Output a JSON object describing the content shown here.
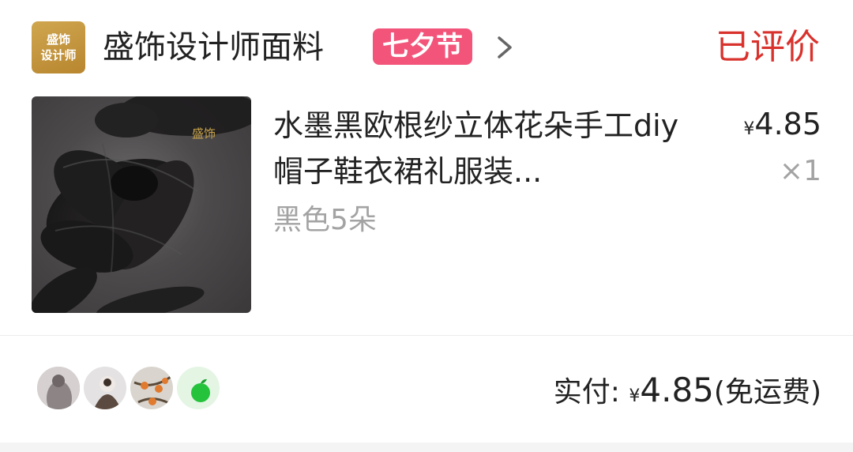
{
  "shop": {
    "logo_line1": "盛饰",
    "logo_line2": "设计师",
    "name": "盛饰设计师面料",
    "festival_tag": "七夕节",
    "status": "已评价"
  },
  "product": {
    "image_watermark": "盛饰",
    "title": "水墨黑欧根纱立体花朵手工diy帽子鞋衣裙礼服装...",
    "variant": "黑色5朵",
    "price_currency": "¥",
    "price_value": "4.85",
    "quantity": "×1"
  },
  "footer": {
    "paid_label": "实付:",
    "paid_currency": "¥",
    "paid_amount": "4.85",
    "shipping_note": "(免运费)"
  },
  "colors": {
    "accent_red": "#d9322d",
    "tag_pink": "#f2547a",
    "logo_gold": "#c39a45",
    "muted_text": "#a3a3a3"
  }
}
